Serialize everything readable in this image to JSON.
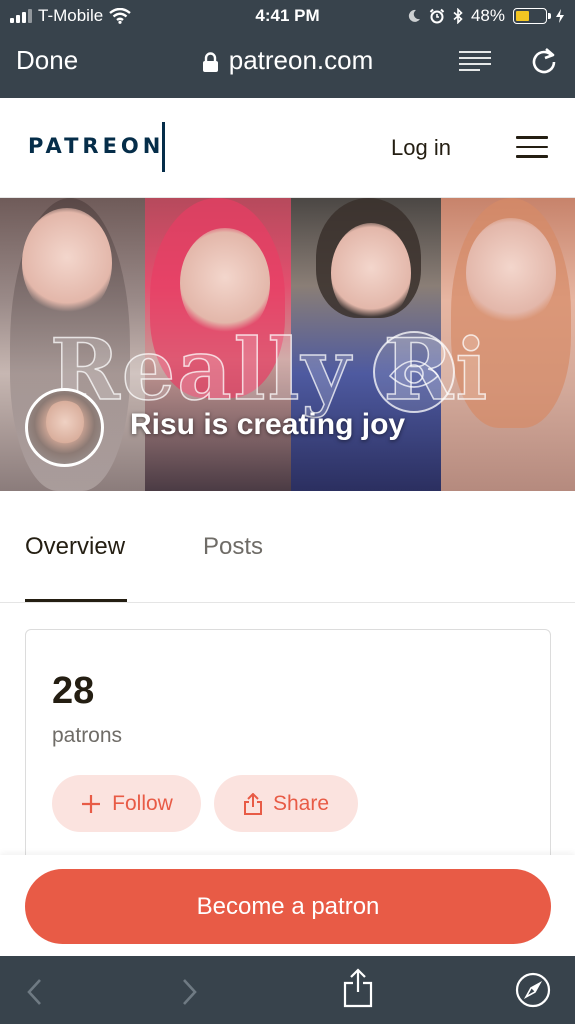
{
  "status_bar": {
    "carrier": "T-Mobile",
    "time": "4:41 PM",
    "battery_percent": "48%",
    "battery_level": 0.48,
    "battery_color": "#f3c623"
  },
  "browser": {
    "done_label": "Done",
    "url": "patreon.com",
    "icons": [
      "lock-icon",
      "reader-view-icon",
      "reload-icon"
    ],
    "toolbar_icons": [
      "back-icon",
      "forward-icon",
      "share-icon",
      "compass-icon"
    ]
  },
  "header": {
    "logo": "PATREON",
    "login_label": "Log in",
    "brand_color": "#052d49"
  },
  "banner": {
    "watermark": "Really Ri",
    "title": "Risu is creating joy"
  },
  "tabs": [
    {
      "label": "Overview",
      "active": true
    },
    {
      "label": "Posts",
      "active": false
    }
  ],
  "stats": {
    "patron_count": "28",
    "patron_label": "patrons",
    "follow_label": "Follow",
    "share_label": "Share"
  },
  "cta": {
    "label": "Become a patron",
    "color": "#e85b46"
  }
}
